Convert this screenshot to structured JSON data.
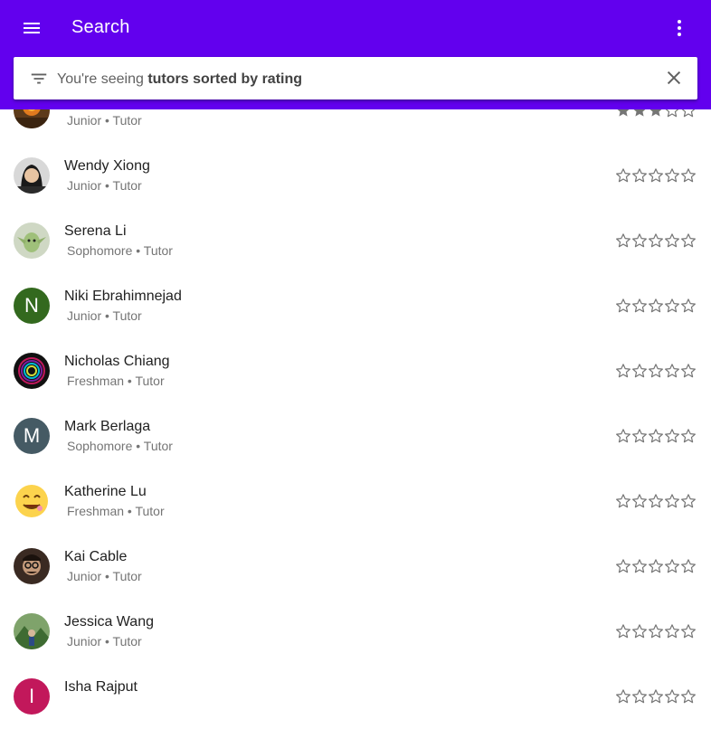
{
  "appbar": {
    "title": "Search",
    "menu_icon": "menu-icon",
    "more_icon": "more-vert-icon",
    "color": "#6200ee"
  },
  "search": {
    "prefix": "You're seeing ",
    "query": "tutors sorted by rating",
    "filter_icon": "filter-list-icon",
    "clear_icon": "close-icon"
  },
  "tutors": [
    {
      "name": "",
      "subtitle": "Junior • Tutor",
      "rating": 3,
      "avatar": "photo-orange"
    },
    {
      "name": "Wendy Xiong",
      "subtitle": "Junior • Tutor",
      "rating": 0,
      "avatar": "photo-person"
    },
    {
      "name": "Serena Li",
      "subtitle": "Sophomore • Tutor",
      "rating": 0,
      "avatar": "photo-yoda"
    },
    {
      "name": "Niki Ebrahimnejad",
      "subtitle": "Junior • Tutor",
      "rating": 0,
      "letter": "N",
      "color": "#33691e"
    },
    {
      "name": "Nicholas Chiang",
      "subtitle": "Freshman • Tutor",
      "rating": 0,
      "avatar": "photo-rings"
    },
    {
      "name": "Mark Berlaga",
      "subtitle": "Sophomore • Tutor",
      "rating": 0,
      "letter": "M",
      "color": "#455a64"
    },
    {
      "name": "Katherine Lu",
      "subtitle": "Freshman • Tutor",
      "rating": 0,
      "avatar": "emoji-smile"
    },
    {
      "name": "Kai Cable",
      "subtitle": "Junior • Tutor",
      "rating": 0,
      "avatar": "photo-glasses"
    },
    {
      "name": "Jessica Wang",
      "subtitle": "Junior • Tutor",
      "rating": 0,
      "avatar": "photo-outdoor"
    },
    {
      "name": "Isha Rajput",
      "subtitle": "",
      "rating": 0,
      "letter": "I",
      "color": "#c2185b"
    }
  ]
}
